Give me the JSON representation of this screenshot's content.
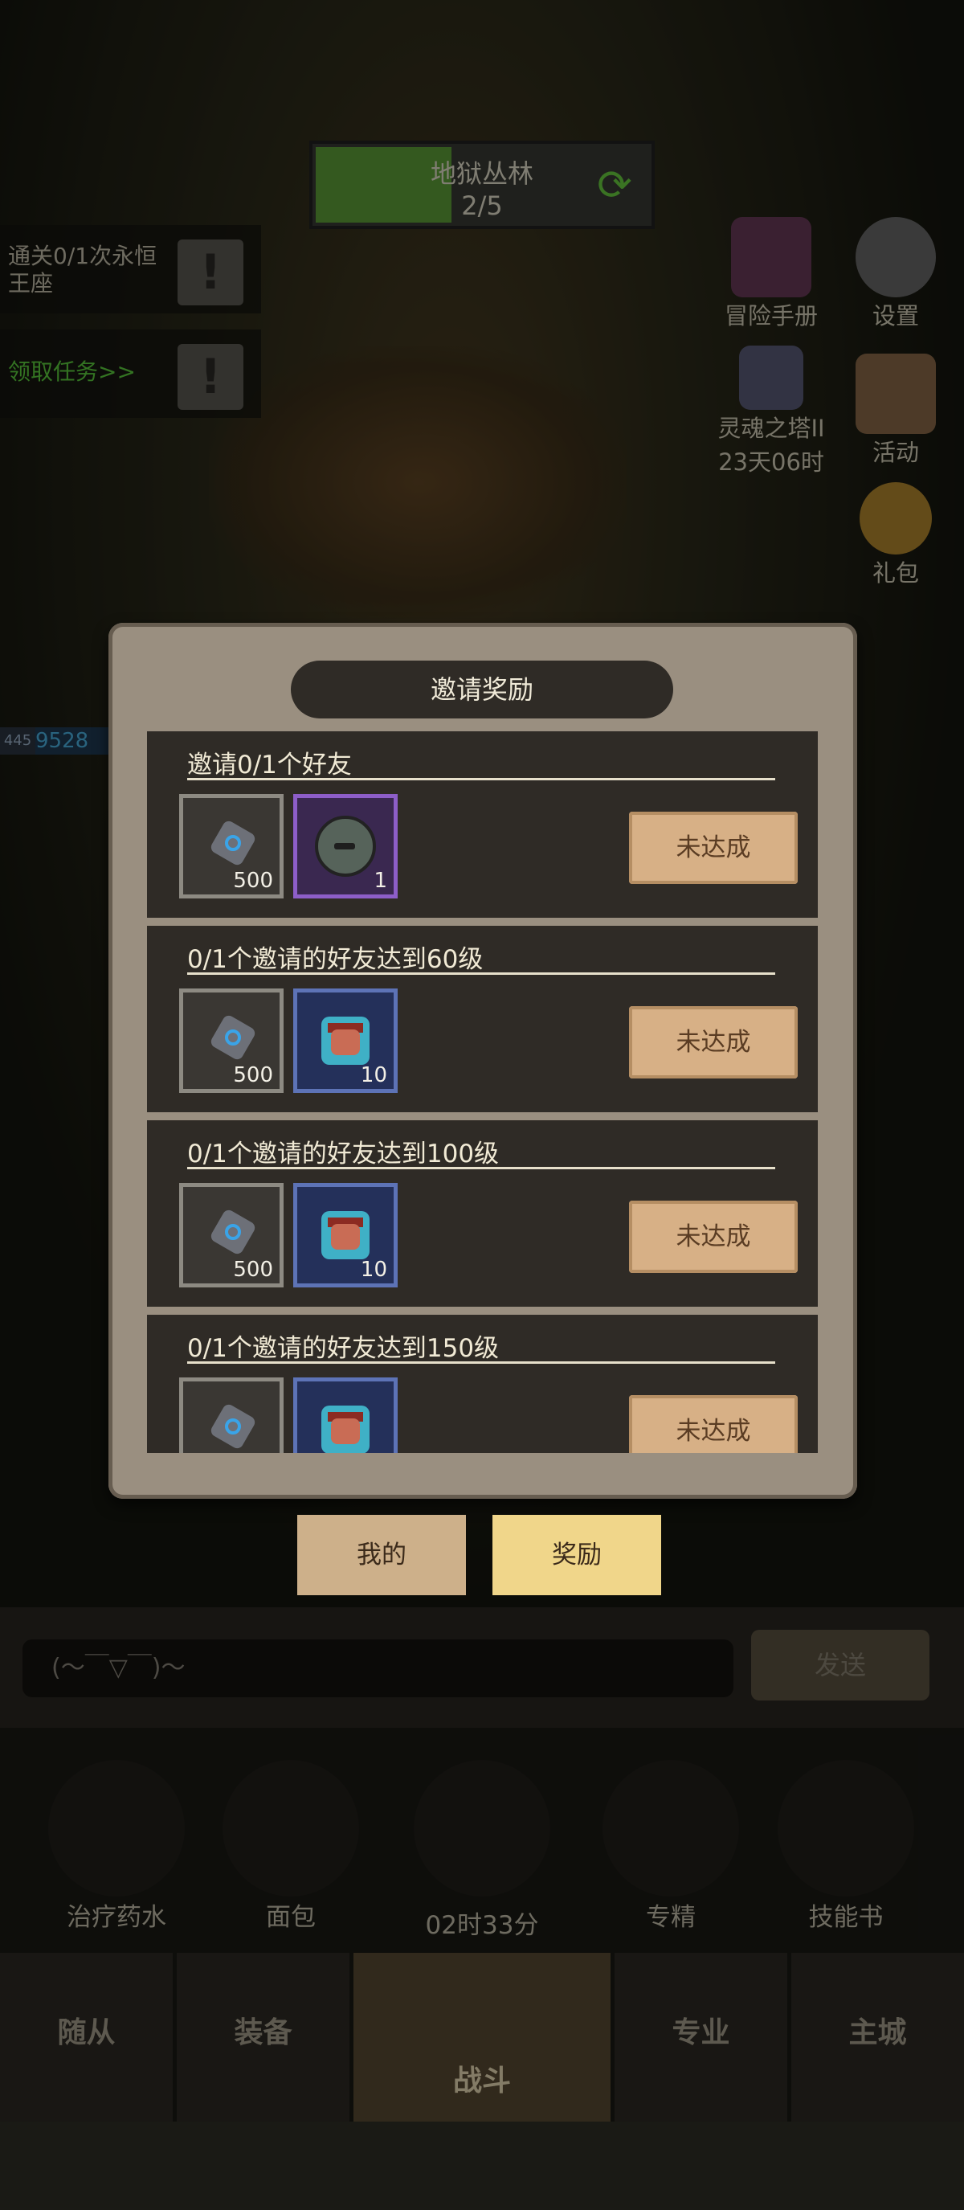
{
  "top": {
    "zone_name": "地狱丛林",
    "zone_progress": "2/5",
    "progress_fraction": 0.4
  },
  "quests": [
    {
      "text": "通关0/1次永恒王座",
      "color": "#c9c3b0"
    },
    {
      "text": "领取任务>>",
      "color": "#5ed23e"
    }
  ],
  "right_icons": {
    "adventure_manual": "冒险手册",
    "settings": "设置",
    "soul_tower": "灵魂之塔II",
    "soul_tower_timer": "23天06时",
    "event": "活动",
    "gift_pack": "礼包"
  },
  "hp": {
    "level": "445",
    "value": "9528"
  },
  "panel": {
    "title": "邀请奖励",
    "rows": [
      {
        "title": "邀请0/1个好友",
        "reward1_qty": "500",
        "reward2_qty": "1",
        "reward2_type": "purple",
        "button": "未达成"
      },
      {
        "title": "0/1个邀请的好友达到60级",
        "reward1_qty": "500",
        "reward2_qty": "10",
        "reward2_type": "blue",
        "button": "未达成"
      },
      {
        "title": "0/1个邀请的好友达到100级",
        "reward1_qty": "500",
        "reward2_qty": "10",
        "reward2_type": "blue",
        "button": "未达成"
      },
      {
        "title": "0/1个邀请的好友达到150级",
        "reward1_qty": "",
        "reward2_qty": "",
        "reward2_type": "blue",
        "button": "未达成"
      }
    ]
  },
  "tabs": {
    "mine": "我的",
    "reward": "奖励"
  },
  "chat": {
    "placeholder": "(～￣▽￣)～",
    "send": "发送"
  },
  "consumables": {
    "potion": "治疗药水",
    "bread": "面包",
    "specialty": "专精",
    "skill_book": "技能书"
  },
  "chest_timer": "02时33分",
  "nav": {
    "followers": "随从",
    "equipment": "装备",
    "battle": "战斗",
    "profession": "专业",
    "city": "主城"
  }
}
